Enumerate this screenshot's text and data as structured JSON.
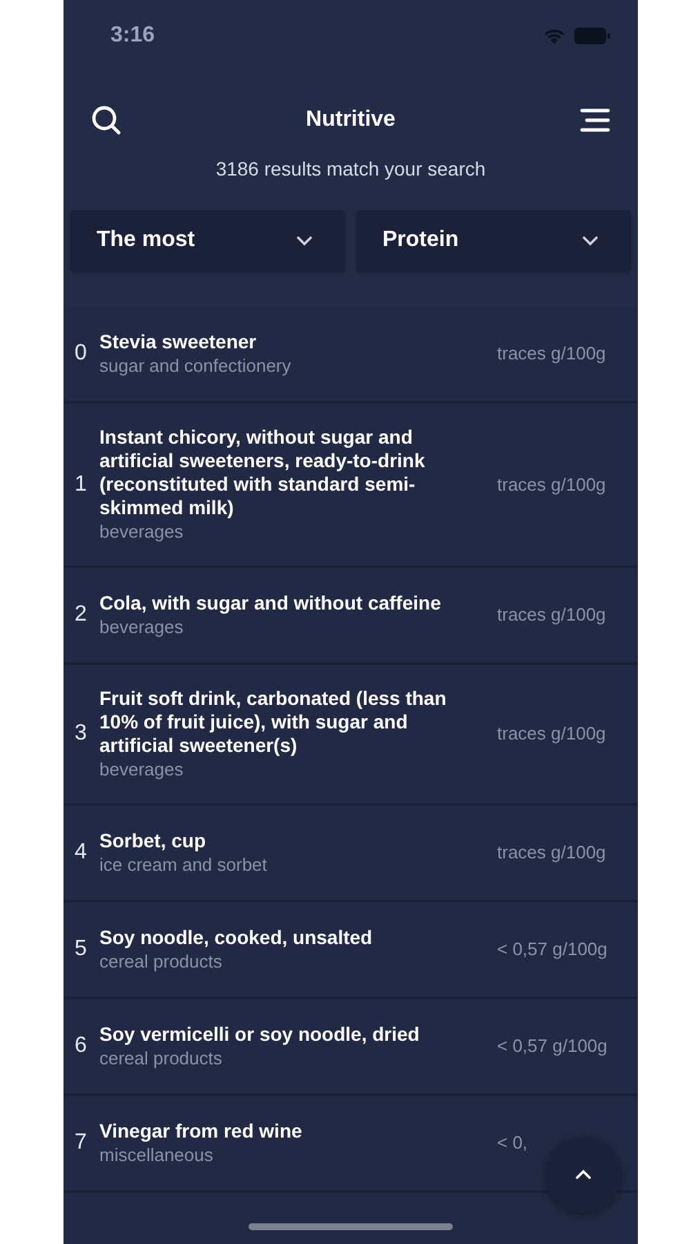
{
  "status_bar": {
    "time": "3:16"
  },
  "header": {
    "title": "Nutritive",
    "subtitle": "3186 results match your search"
  },
  "filters": [
    {
      "label": "The most"
    },
    {
      "label": "Protein"
    }
  ],
  "results": [
    {
      "index": "0",
      "name": "Stevia sweetener",
      "category": "sugar and confectionery",
      "value": "traces g/100g"
    },
    {
      "index": "1",
      "name": "Instant chicory, without sugar and artificial sweeteners, ready-to-drink (reconstituted with standard semi-skimmed milk)",
      "category": "beverages",
      "value": "traces g/100g"
    },
    {
      "index": "2",
      "name": "Cola, with sugar and without caffeine",
      "category": "beverages",
      "value": "traces g/100g"
    },
    {
      "index": "3",
      "name": "Fruit soft drink, carbonated (less than 10% of fruit juice), with sugar and artificial sweetener(s)",
      "category": "beverages",
      "value": "traces g/100g"
    },
    {
      "index": "4",
      "name": "Sorbet, cup",
      "category": "ice cream and sorbet",
      "value": "traces g/100g"
    },
    {
      "index": "5",
      "name": "Soy noodle, cooked, unsalted",
      "category": "cereal products",
      "value": "< 0,57 g/100g"
    },
    {
      "index": "6",
      "name": "Soy vermicelli or soy noodle, dried",
      "category": "cereal products",
      "value": "< 0,57 g/100g"
    },
    {
      "index": "7",
      "name": "Vinegar from red wine",
      "category": "miscellaneous",
      "value": "< 0,"
    }
  ]
}
